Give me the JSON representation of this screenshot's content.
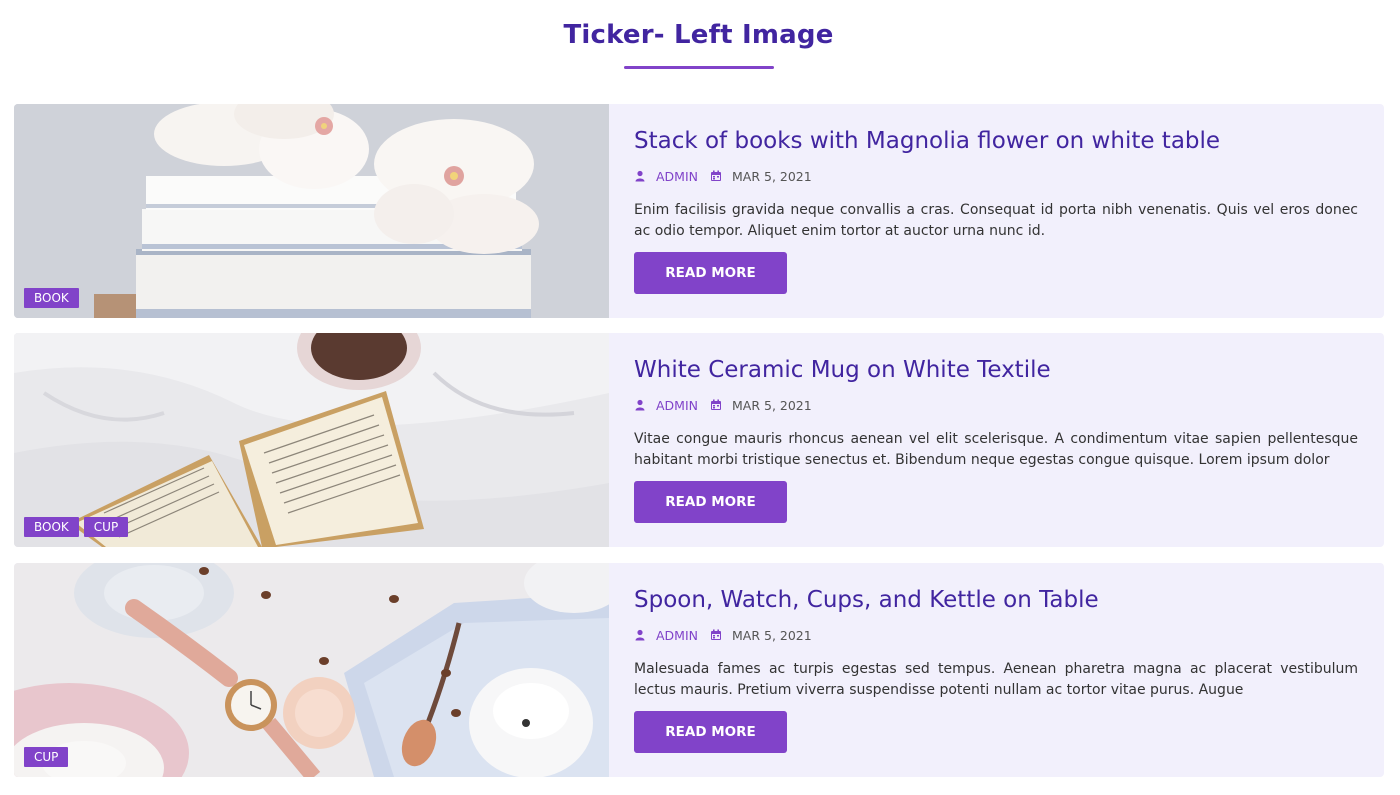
{
  "page": {
    "title": "Ticker- Left Image"
  },
  "theme": {
    "accent": "#8143c9",
    "title_color": "#4125a0",
    "card_bg": "#f2f0fc"
  },
  "posts": [
    {
      "title": "Stack of books with Magnolia flower on white table",
      "author": "ADMIN",
      "date": "MAR 5, 2021",
      "excerpt": "Enim facilisis gravida neque convallis a cras. Consequat id porta nibh venenatis. Quis vel eros donec ac odio tempor. Aliquet enim tortor at auctor urna nunc id.",
      "button": "READ MORE",
      "tags": [
        "BOOK"
      ]
    },
    {
      "title": "White Ceramic Mug on White Textile",
      "author": "ADMIN",
      "date": "MAR 5, 2021",
      "excerpt": "Vitae congue mauris rhoncus aenean vel elit scelerisque. A condimentum vitae sapien pellentesque habitant morbi tristique senectus et. Bibendum neque egestas congue quisque. Lorem ipsum dolor",
      "button": "READ MORE",
      "tags": [
        "BOOK",
        "CUP"
      ]
    },
    {
      "title": "Spoon, Watch, Cups, and Kettle on Table",
      "author": "ADMIN",
      "date": "MAR 5, 2021",
      "excerpt": "Malesuada fames ac turpis egestas sed tempus. Aenean pharetra magna ac placerat vestibulum lectus mauris. Pretium viverra suspendisse potenti nullam ac tortor vitae purus. Augue",
      "button": "READ MORE",
      "tags": [
        "CUP"
      ]
    }
  ],
  "icons": {
    "author": "user-icon",
    "date": "calendar-icon"
  }
}
